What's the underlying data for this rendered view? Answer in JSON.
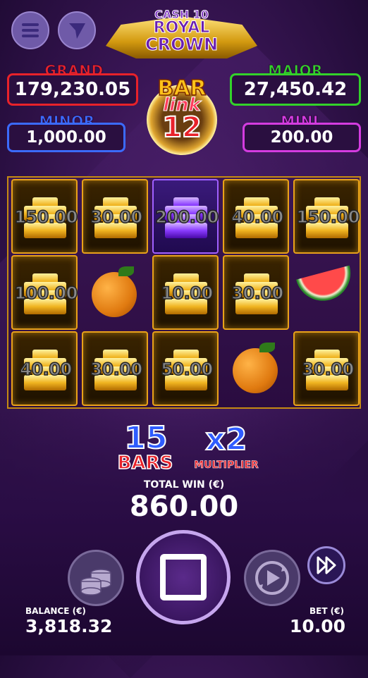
{
  "logo": {
    "line1": "CASH 10",
    "line2": "ROYAL",
    "line3": "CROWN"
  },
  "jackpots": {
    "grand": {
      "label": "GRAND",
      "value": "179,230.05",
      "color": "#e8222a"
    },
    "major": {
      "label": "MAJOR",
      "value": "27,450.42",
      "color": "#33d22a"
    },
    "minor": {
      "label": "MINOR",
      "value": "1,000.00",
      "color": "#3b6bff"
    },
    "mini": {
      "label": "MINI",
      "value": "200.00",
      "color": "#d43ce0"
    }
  },
  "badge": {
    "word1": "BAR",
    "word2": "link",
    "number": "12"
  },
  "grid": {
    "cells": [
      {
        "symbol": "gold-bar",
        "value": "150.00"
      },
      {
        "symbol": "gold-bar",
        "value": "30.00"
      },
      {
        "symbol": "purple-bar",
        "value": "200.00"
      },
      {
        "symbol": "gold-bar",
        "value": "40.00"
      },
      {
        "symbol": "gold-bar",
        "value": "150.00"
      },
      {
        "symbol": "gold-bar",
        "value": "100.00"
      },
      {
        "symbol": "orange",
        "value": ""
      },
      {
        "symbol": "gold-bar",
        "value": "10.00"
      },
      {
        "symbol": "gold-bar",
        "value": "30.00"
      },
      {
        "symbol": "watermelon",
        "value": ""
      },
      {
        "symbol": "gold-bar",
        "value": "40.00"
      },
      {
        "symbol": "gold-bar",
        "value": "30.00"
      },
      {
        "symbol": "gold-bar",
        "value": "50.00"
      },
      {
        "symbol": "orange",
        "value": ""
      },
      {
        "symbol": "gold-bar",
        "value": "30.00"
      }
    ]
  },
  "collect": {
    "count": "15",
    "count_label": "BARS",
    "multiplier": "x2",
    "multiplier_label": "MULTIPLIER"
  },
  "win": {
    "label": "TOTAL WIN (€)",
    "value": "860.00"
  },
  "footer": {
    "balance_label": "BALANCE (€)",
    "balance_value": "3,818.32",
    "bet_label": "BET (€)",
    "bet_value": "10.00"
  }
}
